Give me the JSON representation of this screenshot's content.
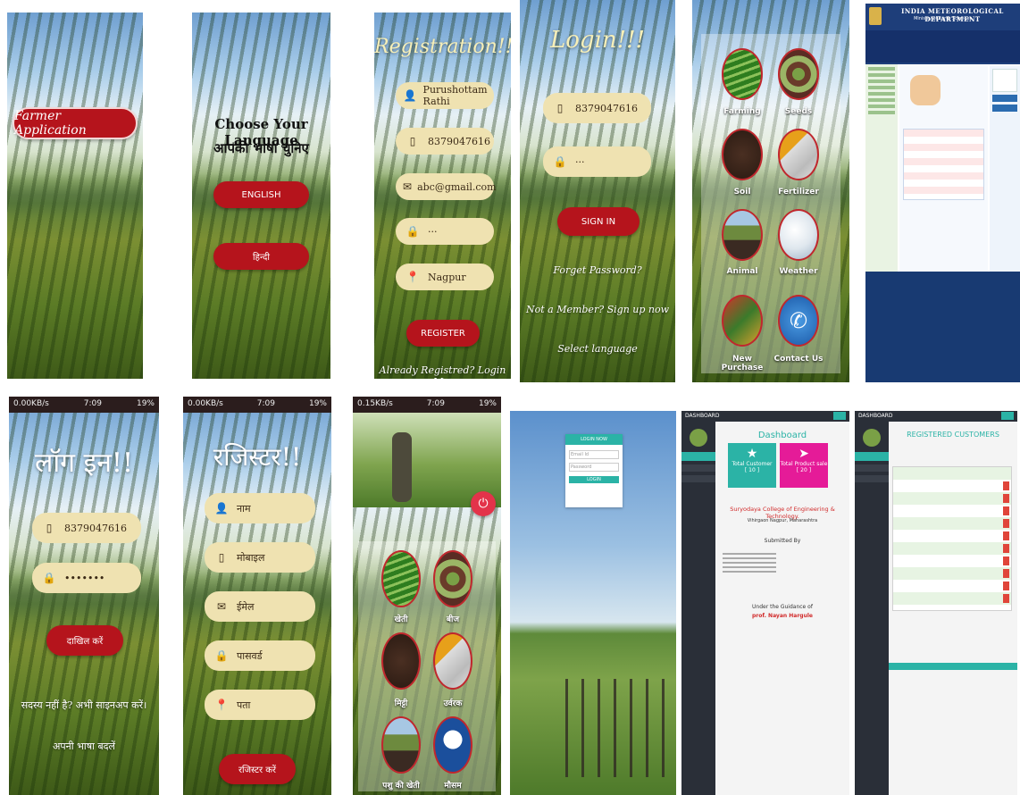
{
  "splash": {
    "title": "Farmer Application"
  },
  "language": {
    "heading_en": "Choose Your Language",
    "heading_hi": "आपकी भाषा चुनिए",
    "english_button": "ENGLISH",
    "hindi_button": "हिन्दी"
  },
  "registration": {
    "title": "Registration!!!",
    "name_value": "Purushottam Rathi",
    "mobile_value": "8379047616",
    "email_value": "abc@gmail.com",
    "password_value": "···",
    "address_value": "Nagpur",
    "register_button": "REGISTER",
    "footer_link": "Already Registred? Login Me."
  },
  "login": {
    "title": "Login!!!",
    "mobile_value": "8379047616",
    "password_value": "···",
    "signin_button": "SIGN IN",
    "forgot_link": "Forget Password?",
    "signup_link": "Not a Member? Sign up now",
    "language_link": "Select language"
  },
  "menu_en": {
    "items": [
      "Farming",
      "Seeds",
      "Soil",
      "Fertilizer",
      "Animal",
      "Weather",
      "New Purchase",
      "Contact Us"
    ]
  },
  "imd": {
    "title": "INDIA METEOROLOGICAL DEPARTMENT",
    "subtitle": "Ministry of Earth Sciences"
  },
  "login_hi": {
    "status_net": "0.00KB/s",
    "status_time": "7:09",
    "status_battery": "19%",
    "title": "लॉग इन!!",
    "mobile_value": "8379047616",
    "password_value": "•••••••",
    "submit_button": "दाखिल करें",
    "signup_link": "सदस्य नहीं है? अभी साइनअप करें।",
    "language_link": "अपनी भाषा बदलें"
  },
  "register_hi": {
    "status_net": "0.00KB/s",
    "status_time": "7:09",
    "status_battery": "19%",
    "title": "रजिस्टर!!",
    "name_placeholder": "नाम",
    "mobile_placeholder": "मोबाइल",
    "email_placeholder": "ईमेल",
    "password_placeholder": "पासवर्ड",
    "address_placeholder": "पता",
    "register_button": "रजिस्टर करें"
  },
  "menu_hi": {
    "status_net": "0.15KB/s",
    "status_time": "7:09",
    "status_battery": "19%",
    "items": [
      "खेती",
      "बीज",
      "मिट्टी",
      "उर्वरक",
      "पशु की खेती",
      "मौसम"
    ]
  },
  "admin_login": {
    "title": "LOGIN NOW",
    "email_placeholder": "Email Id",
    "password_placeholder": "Password",
    "login_button": "LOGIN"
  },
  "dashboard": {
    "brand": "DASHBOARD",
    "title": "Dashboard",
    "total_customer_label": "Total Customer",
    "total_customer_value": "[ 10 ]",
    "total_sale_label": "Total Product sale",
    "total_sale_value": "[ 20 ]",
    "college": "Suryodaya College of Engineering & Technology.",
    "place": "Vihirgaon Nagpur, Maharashtra",
    "submitted_by": "Submitted By",
    "guidance": "Under the Guidance of",
    "guide": "prof. Nayan Hargule"
  },
  "customers": {
    "brand": "DASHBOARD",
    "title": "REGISTERED CUSTOMERS"
  },
  "colors": {
    "red_button": "#b5141c",
    "pill": "#efe2b1",
    "teal": "#2bb3a6",
    "magenta": "#e51b98"
  }
}
